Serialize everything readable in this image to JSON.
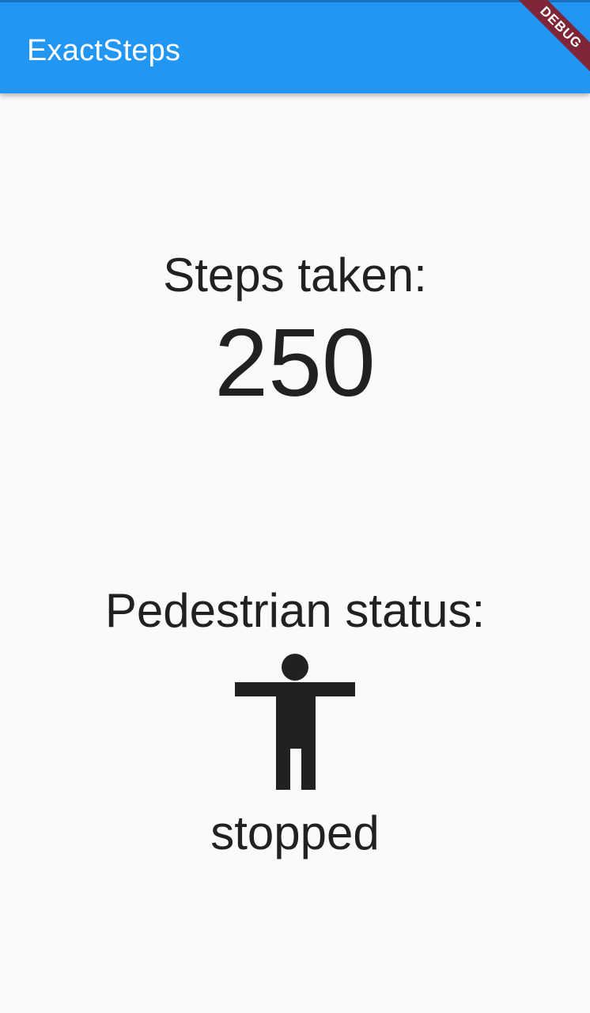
{
  "app_bar": {
    "title": "ExactSteps",
    "color": "#2196f3"
  },
  "debug_banner": {
    "label": "DEBUG"
  },
  "steps": {
    "label": "Steps taken:",
    "value": "250"
  },
  "pedestrian": {
    "label": "Pedestrian status:",
    "icon": "accessibility-icon",
    "status": "stopped"
  }
}
